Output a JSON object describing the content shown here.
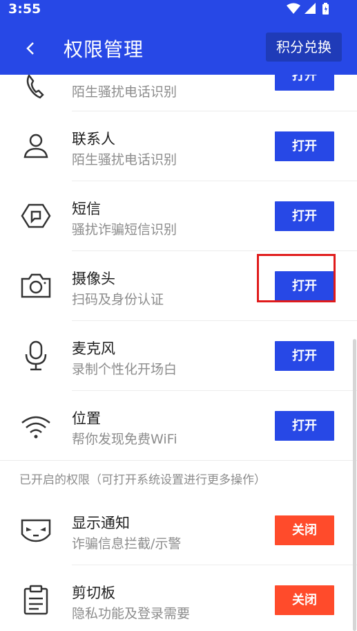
{
  "status_bar": {
    "time": "3:55",
    "icons": [
      "wifi-icon",
      "signal-icon",
      "battery-icon"
    ]
  },
  "header": {
    "back_icon": "back-arrow-icon",
    "title": "权限管理",
    "exchange_label": "积分兑换"
  },
  "permissions": [
    {
      "name": "",
      "desc": "陌生骚扰电话识别",
      "icon": "phone-icon",
      "button": "打开"
    },
    {
      "name": "联系人",
      "desc": "陌生骚扰电话识别",
      "icon": "contact-person-icon",
      "button": "打开"
    },
    {
      "name": "短信",
      "desc": "骚扰诈骗短信识别",
      "icon": "sms-shield-icon",
      "button": "打开"
    },
    {
      "name": "摄像头",
      "desc": "扫码及身份认证",
      "icon": "camera-icon",
      "button": "打开"
    },
    {
      "name": "麦克风",
      "desc": "录制个性化开场白",
      "icon": "microphone-icon",
      "button": "打开"
    },
    {
      "name": "位置",
      "desc": "帮你发现免费WiFi",
      "icon": "wifi-location-icon",
      "button": "打开"
    }
  ],
  "enabled_section_note": "已开启的权限（可打开系统设置进行更多操作）",
  "enabled_permissions": [
    {
      "name": "显示通知",
      "desc": "诈骗信息拦截/示警",
      "icon": "mask-notification-icon",
      "button": "关闭"
    },
    {
      "name": "剪切板",
      "desc": "隐私功能及登录需要",
      "icon": "clipboard-icon",
      "button": "关闭"
    }
  ],
  "colors": {
    "primary": "#2748e6",
    "danger": "#ff4b2b",
    "highlight": "#e01b1b"
  }
}
